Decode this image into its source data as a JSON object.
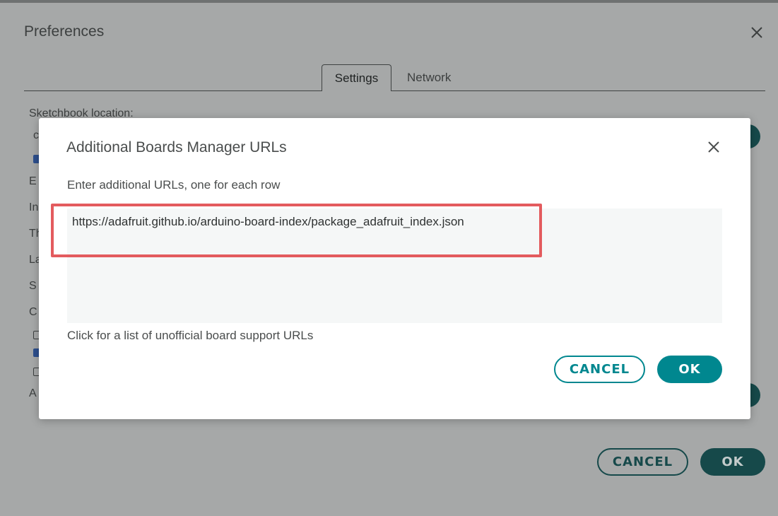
{
  "preferences": {
    "title": "Preferences",
    "tabs": [
      {
        "label": "Settings",
        "active": true
      },
      {
        "label": "Network",
        "active": false
      }
    ],
    "sketchbook_label": "Sketchbook location:",
    "cropped_labels": [
      "c",
      "E",
      "In",
      "Th",
      "La",
      "S",
      "C",
      "A"
    ],
    "cancel_label": "CANCEL",
    "ok_label": "OK"
  },
  "dialog": {
    "title": "Additional Boards Manager URLs",
    "instruction": "Enter additional URLs, one for each row",
    "url_value": "https://adafruit.github.io/arduino-board-index/package_adafruit_index.json",
    "link_text": "Click for a list of unofficial board support URLs",
    "cancel_label": "CANCEL",
    "ok_label": "OK"
  },
  "colors": {
    "accent": "#00878f",
    "highlight": "#e35b5e",
    "overlay_accent": "#16494a"
  },
  "icons": {
    "close": "close-icon"
  }
}
